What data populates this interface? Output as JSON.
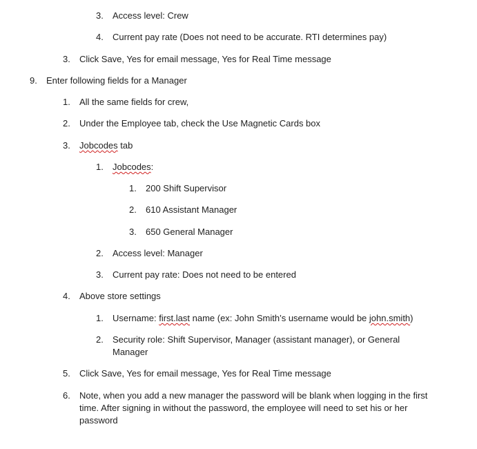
{
  "document": {
    "items": [
      {
        "num": "3.",
        "text": "Access level: Crew"
      },
      {
        "num": "4.",
        "text": "Current pay rate (Does not need to be accurate. RTI determines pay)"
      },
      {
        "num": "3.",
        "text": "Click Save, Yes for email message, Yes for Real Time message"
      },
      {
        "num": "9.",
        "text": "Enter following fields for a Manager"
      },
      {
        "num": "1.",
        "text": "All the same fields for crew,"
      },
      {
        "num": "2.",
        "text": "Under the Employee tab, check the Use Magnetic Cards box"
      },
      {
        "num": "3.",
        "text_a": "Jobcodes",
        "text_b": " tab"
      },
      {
        "num": "1.",
        "text_a": "Jobcodes",
        "text_b": ":"
      },
      {
        "num": "1.",
        "text": "200 Shift Supervisor"
      },
      {
        "num": "2.",
        "text": "610 Assistant Manager"
      },
      {
        "num": "3.",
        "text": "650 General Manager"
      },
      {
        "num": "2.",
        "text": "Access level: Manager"
      },
      {
        "num": "3.",
        "text": "Current pay rate: Does not need to be entered"
      },
      {
        "num": "4.",
        "text": "Above store settings"
      },
      {
        "num": "1.",
        "text_a": "Username: ",
        "text_b": "first.last",
        "text_c": " name (ex: John Smith’s username would be ",
        "text_d": "john.smith",
        "text_e": ")"
      },
      {
        "num": "2.",
        "text_1": "Security role: Shift Supervisor, Manager (assistant manager), or General",
        "text_2": "Manager"
      },
      {
        "num": "5.",
        "text": "Click Save, Yes for email message, Yes for Real Time message"
      },
      {
        "num": "6.",
        "text_1": "Note, when you add a new manager the password will be blank when logging in the first",
        "text_2": "time. After signing in without the password, the employee will need to set his or her",
        "text_3": "password"
      }
    ]
  }
}
